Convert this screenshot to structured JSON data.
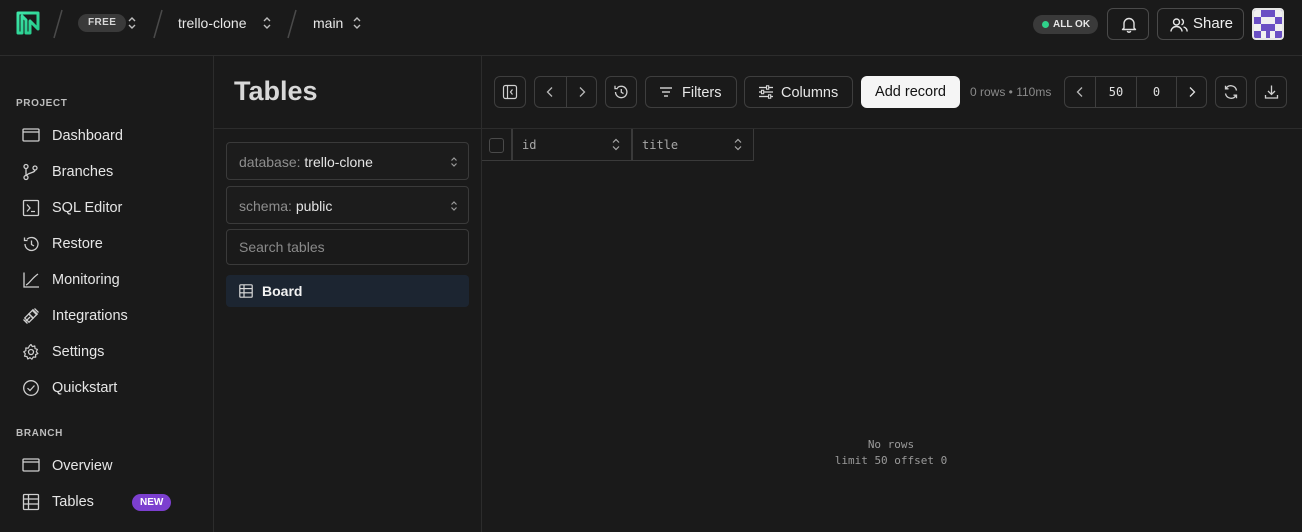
{
  "topbar": {
    "plan_badge": "FREE",
    "project": "trello-clone",
    "branch": "main",
    "status": "ALL OK",
    "share_label": "Share"
  },
  "sidebar": {
    "project_section": "PROJECT",
    "project_items": [
      {
        "label": "Dashboard",
        "icon": "dashboard-icon"
      },
      {
        "label": "Branches",
        "icon": "branches-icon"
      },
      {
        "label": "SQL Editor",
        "icon": "sql-editor-icon"
      },
      {
        "label": "Restore",
        "icon": "restore-icon"
      },
      {
        "label": "Monitoring",
        "icon": "monitoring-icon"
      },
      {
        "label": "Integrations",
        "icon": "integrations-icon"
      },
      {
        "label": "Settings",
        "icon": "settings-icon"
      },
      {
        "label": "Quickstart",
        "icon": "quickstart-icon"
      }
    ],
    "branch_section": "BRANCH",
    "branch_items": [
      {
        "label": "Overview",
        "icon": "overview-icon"
      },
      {
        "label": "Tables",
        "icon": "tables-icon",
        "badge": "NEW"
      }
    ]
  },
  "tables_panel": {
    "title": "Tables",
    "database_label": "database:",
    "database_value": "trello-clone",
    "schema_label": "schema:",
    "schema_value": "public",
    "search_placeholder": "Search tables",
    "tables": [
      {
        "name": "Board"
      }
    ]
  },
  "toolbar": {
    "filters_label": "Filters",
    "columns_label": "Columns",
    "add_record_label": "Add record",
    "rows_info": "0 rows • 110ms",
    "limit": "50",
    "offset": "0"
  },
  "grid": {
    "columns": [
      "id",
      "title"
    ],
    "empty_line1": "No rows",
    "empty_line2": "limit 50 offset 0"
  },
  "colors": {
    "background": "#1a1a1a",
    "accent_green": "#2fd18a",
    "new_badge": "#7c3fcf",
    "selected_table_bg": "#1c2531"
  }
}
